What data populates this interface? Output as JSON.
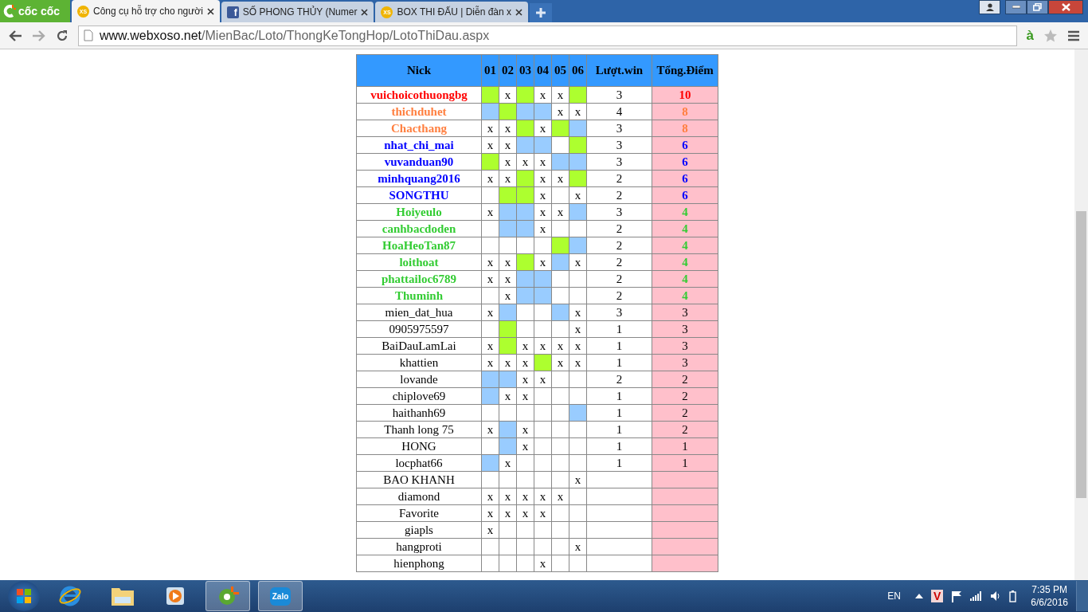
{
  "browser": {
    "logo": "cốc cốc",
    "tabs": [
      {
        "kind": "site",
        "icon_text": "XS",
        "title": "Công cụ hỗ trợ cho người",
        "selected": true
      },
      {
        "kind": "social",
        "icon_text": "f",
        "title": "SỐ PHONG THỦY (Numer",
        "selected": false
      },
      {
        "kind": "site",
        "icon_text": "XS",
        "title": "BOX THI ĐẤU | Diễn đàn x",
        "selected": false
      }
    ],
    "url": {
      "host": "www.webxoso.net",
      "path": "/MienBac/Loto/ThongKeTongHop/LotoThiDau.aspx"
    },
    "extension_text": "à"
  },
  "table": {
    "columns": {
      "nick": "Nick",
      "days": [
        "01",
        "02",
        "03",
        "04",
        "05",
        "06"
      ],
      "wins": "Lượt.win",
      "points": "Tổng.Điểm"
    },
    "rows": [
      {
        "nick": "vuichoicothuongbg",
        "color": "#ff0000",
        "bold": true,
        "cells": [
          {
            "kind": "win"
          },
          {
            "kind": "mark",
            "text": "x"
          },
          {
            "kind": "win"
          },
          {
            "kind": "mark",
            "text": "x"
          },
          {
            "kind": "mark",
            "text": "x"
          },
          {
            "kind": "win"
          }
        ],
        "wins": "3",
        "points": "10"
      },
      {
        "nick": "thichduhet",
        "color": "#ff7f3f",
        "bold": true,
        "cells": [
          {
            "kind": "near"
          },
          {
            "kind": "win"
          },
          {
            "kind": "near"
          },
          {
            "kind": "near"
          },
          {
            "kind": "mark",
            "text": "x"
          },
          {
            "kind": "mark",
            "text": "x"
          }
        ],
        "wins": "4",
        "points": "8"
      },
      {
        "nick": "Chacthang",
        "color": "#ff7f3f",
        "bold": true,
        "cells": [
          {
            "kind": "mark",
            "text": "x"
          },
          {
            "kind": "mark",
            "text": "x"
          },
          {
            "kind": "win"
          },
          {
            "kind": "mark",
            "text": "x"
          },
          {
            "kind": "win"
          },
          {
            "kind": "near"
          }
        ],
        "wins": "3",
        "points": "8"
      },
      {
        "nick": "nhat_chi_mai",
        "color": "#0000ff",
        "bold": true,
        "cells": [
          {
            "kind": "mark",
            "text": "x"
          },
          {
            "kind": "mark",
            "text": "x"
          },
          {
            "kind": "near"
          },
          {
            "kind": "near"
          },
          {
            "kind": "blank"
          },
          {
            "kind": "win"
          }
        ],
        "wins": "3",
        "points": "6"
      },
      {
        "nick": "vuvanduan90",
        "color": "#0000ff",
        "bold": true,
        "cells": [
          {
            "kind": "win"
          },
          {
            "kind": "mark",
            "text": "x"
          },
          {
            "kind": "mark",
            "text": "x"
          },
          {
            "kind": "mark",
            "text": "x"
          },
          {
            "kind": "near"
          },
          {
            "kind": "near"
          }
        ],
        "wins": "3",
        "points": "6"
      },
      {
        "nick": "minhquang2016",
        "color": "#0000ff",
        "bold": true,
        "cells": [
          {
            "kind": "mark",
            "text": "x"
          },
          {
            "kind": "mark",
            "text": "x"
          },
          {
            "kind": "win"
          },
          {
            "kind": "mark",
            "text": "x"
          },
          {
            "kind": "mark",
            "text": "x"
          },
          {
            "kind": "win"
          }
        ],
        "wins": "2",
        "points": "6"
      },
      {
        "nick": "SONGTHU",
        "color": "#0000ff",
        "bold": true,
        "cells": [
          {
            "kind": "blank"
          },
          {
            "kind": "win"
          },
          {
            "kind": "win"
          },
          {
            "kind": "mark",
            "text": "x"
          },
          {
            "kind": "blank"
          },
          {
            "kind": "mark",
            "text": "x"
          }
        ],
        "wins": "2",
        "points": "6"
      },
      {
        "nick": "Hoiyeulo",
        "color": "#33cc33",
        "bold": true,
        "cells": [
          {
            "kind": "mark",
            "text": "x"
          },
          {
            "kind": "near"
          },
          {
            "kind": "near"
          },
          {
            "kind": "mark",
            "text": "x"
          },
          {
            "kind": "mark",
            "text": "x"
          },
          {
            "kind": "near"
          }
        ],
        "wins": "3",
        "points": "4"
      },
      {
        "nick": "canhbacdoden",
        "color": "#33cc33",
        "bold": true,
        "cells": [
          {
            "kind": "blank"
          },
          {
            "kind": "near"
          },
          {
            "kind": "near"
          },
          {
            "kind": "mark",
            "text": "x"
          },
          {
            "kind": "blank"
          },
          {
            "kind": "blank"
          }
        ],
        "wins": "2",
        "points": "4"
      },
      {
        "nick": "HoaHeoTan87",
        "color": "#33cc33",
        "bold": true,
        "cells": [
          {
            "kind": "blank"
          },
          {
            "kind": "blank"
          },
          {
            "kind": "blank"
          },
          {
            "kind": "blank"
          },
          {
            "kind": "win"
          },
          {
            "kind": "near"
          }
        ],
        "wins": "2",
        "points": "4"
      },
      {
        "nick": "loithoat",
        "color": "#33cc33",
        "bold": true,
        "cells": [
          {
            "kind": "mark",
            "text": "x"
          },
          {
            "kind": "mark",
            "text": "x"
          },
          {
            "kind": "win"
          },
          {
            "kind": "mark",
            "text": "x"
          },
          {
            "kind": "near"
          },
          {
            "kind": "mark",
            "text": "x"
          }
        ],
        "wins": "2",
        "points": "4"
      },
      {
        "nick": "phattailoc6789",
        "color": "#33cc33",
        "bold": true,
        "cells": [
          {
            "kind": "mark",
            "text": "x"
          },
          {
            "kind": "mark",
            "text": "x"
          },
          {
            "kind": "near"
          },
          {
            "kind": "near"
          },
          {
            "kind": "blank"
          },
          {
            "kind": "blank"
          }
        ],
        "wins": "2",
        "points": "4"
      },
      {
        "nick": "Thuminh",
        "color": "#33cc33",
        "bold": true,
        "cells": [
          {
            "kind": "blank"
          },
          {
            "kind": "mark",
            "text": "x"
          },
          {
            "kind": "near"
          },
          {
            "kind": "near"
          },
          {
            "kind": "blank"
          },
          {
            "kind": "blank"
          }
        ],
        "wins": "2",
        "points": "4"
      },
      {
        "nick": "mien_dat_hua",
        "color": "#000000",
        "bold": false,
        "cells": [
          {
            "kind": "mark",
            "text": "x"
          },
          {
            "kind": "near"
          },
          {
            "kind": "blank"
          },
          {
            "kind": "blank"
          },
          {
            "kind": "near"
          },
          {
            "kind": "mark",
            "text": "x"
          }
        ],
        "wins": "3",
        "points": "3"
      },
      {
        "nick": "0905975597",
        "color": "#000000",
        "bold": false,
        "cells": [
          {
            "kind": "blank"
          },
          {
            "kind": "win"
          },
          {
            "kind": "blank"
          },
          {
            "kind": "blank"
          },
          {
            "kind": "blank"
          },
          {
            "kind": "mark",
            "text": "x"
          }
        ],
        "wins": "1",
        "points": "3"
      },
      {
        "nick": "BaiDauLamLai",
        "color": "#000000",
        "bold": false,
        "cells": [
          {
            "kind": "mark",
            "text": "x"
          },
          {
            "kind": "win"
          },
          {
            "kind": "mark",
            "text": "x"
          },
          {
            "kind": "mark",
            "text": "x"
          },
          {
            "kind": "mark",
            "text": "x"
          },
          {
            "kind": "mark",
            "text": "x"
          }
        ],
        "wins": "1",
        "points": "3"
      },
      {
        "nick": "khattien",
        "color": "#000000",
        "bold": false,
        "cells": [
          {
            "kind": "mark",
            "text": "x"
          },
          {
            "kind": "mark",
            "text": "x"
          },
          {
            "kind": "mark",
            "text": "x"
          },
          {
            "kind": "win"
          },
          {
            "kind": "mark",
            "text": "x"
          },
          {
            "kind": "mark",
            "text": "x"
          }
        ],
        "wins": "1",
        "points": "3"
      },
      {
        "nick": "lovande",
        "color": "#000000",
        "bold": false,
        "cells": [
          {
            "kind": "near"
          },
          {
            "kind": "near"
          },
          {
            "kind": "mark",
            "text": "x"
          },
          {
            "kind": "mark",
            "text": "x"
          },
          {
            "kind": "blank"
          },
          {
            "kind": "blank"
          }
        ],
        "wins": "2",
        "points": "2"
      },
      {
        "nick": "chiplove69",
        "color": "#000000",
        "bold": false,
        "cells": [
          {
            "kind": "near"
          },
          {
            "kind": "mark",
            "text": "x"
          },
          {
            "kind": "mark",
            "text": "x"
          },
          {
            "kind": "blank"
          },
          {
            "kind": "blank"
          },
          {
            "kind": "blank"
          }
        ],
        "wins": "1",
        "points": "2"
      },
      {
        "nick": "haithanh69",
        "color": "#000000",
        "bold": false,
        "cells": [
          {
            "kind": "blank"
          },
          {
            "kind": "blank"
          },
          {
            "kind": "blank"
          },
          {
            "kind": "blank"
          },
          {
            "kind": "blank"
          },
          {
            "kind": "near"
          }
        ],
        "wins": "1",
        "points": "2"
      },
      {
        "nick": "Thanh long 75",
        "color": "#000000",
        "bold": false,
        "cells": [
          {
            "kind": "mark",
            "text": "x"
          },
          {
            "kind": "near"
          },
          {
            "kind": "mark",
            "text": "x"
          },
          {
            "kind": "blank"
          },
          {
            "kind": "blank"
          },
          {
            "kind": "blank"
          }
        ],
        "wins": "1",
        "points": "2"
      },
      {
        "nick": "HONG",
        "color": "#000000",
        "bold": false,
        "cells": [
          {
            "kind": "blank"
          },
          {
            "kind": "near"
          },
          {
            "kind": "mark",
            "text": "x"
          },
          {
            "kind": "blank"
          },
          {
            "kind": "blank"
          },
          {
            "kind": "blank"
          }
        ],
        "wins": "1",
        "points": "1"
      },
      {
        "nick": "locphat66",
        "color": "#000000",
        "bold": false,
        "cells": [
          {
            "kind": "near"
          },
          {
            "kind": "mark",
            "text": "x"
          },
          {
            "kind": "blank"
          },
          {
            "kind": "blank"
          },
          {
            "kind": "blank"
          },
          {
            "kind": "blank"
          }
        ],
        "wins": "1",
        "points": "1"
      },
      {
        "nick": "BAO KHANH",
        "color": "#000000",
        "bold": false,
        "cells": [
          {
            "kind": "blank"
          },
          {
            "kind": "blank"
          },
          {
            "kind": "blank"
          },
          {
            "kind": "blank"
          },
          {
            "kind": "blank"
          },
          {
            "kind": "mark",
            "text": "x"
          }
        ]
      },
      {
        "nick": "diamond",
        "color": "#000000",
        "bold": false,
        "cells": [
          {
            "kind": "mark",
            "text": "x"
          },
          {
            "kind": "mark",
            "text": "x"
          },
          {
            "kind": "mark",
            "text": "x"
          },
          {
            "kind": "mark",
            "text": "x"
          },
          {
            "kind": "mark",
            "text": "x"
          },
          {
            "kind": "blank"
          }
        ]
      },
      {
        "nick": "Favorite",
        "color": "#000000",
        "bold": false,
        "cells": [
          {
            "kind": "mark",
            "text": "x"
          },
          {
            "kind": "mark",
            "text": "x"
          },
          {
            "kind": "mark",
            "text": "x"
          },
          {
            "kind": "mark",
            "text": "x"
          },
          {
            "kind": "blank"
          },
          {
            "kind": "blank"
          }
        ]
      },
      {
        "nick": "giapls",
        "color": "#000000",
        "bold": false,
        "cells": [
          {
            "kind": "mark",
            "text": "x"
          },
          {
            "kind": "blank"
          },
          {
            "kind": "blank"
          },
          {
            "kind": "blank"
          },
          {
            "kind": "blank"
          },
          {
            "kind": "blank"
          }
        ]
      },
      {
        "nick": "hangproti",
        "color": "#000000",
        "bold": false,
        "cells": [
          {
            "kind": "blank"
          },
          {
            "kind": "blank"
          },
          {
            "kind": "blank"
          },
          {
            "kind": "blank"
          },
          {
            "kind": "blank"
          },
          {
            "kind": "mark",
            "text": "x"
          }
        ]
      },
      {
        "nick": "hienphong",
        "color": "#000000",
        "bold": false,
        "cells": [
          {
            "kind": "blank"
          },
          {
            "kind": "blank"
          },
          {
            "kind": "blank"
          },
          {
            "kind": "mark",
            "text": "x"
          },
          {
            "kind": "blank"
          },
          {
            "kind": "blank"
          }
        ]
      }
    ]
  },
  "taskbar": {
    "apps": [
      {
        "kind": "ie",
        "active": false
      },
      {
        "kind": "folder",
        "active": false
      },
      {
        "kind": "media",
        "active": false
      },
      {
        "kind": "coccoc",
        "active": true
      },
      {
        "kind": "zalo",
        "active": true,
        "label": "Zalo"
      }
    ],
    "language": "EN",
    "tray_app_text": "V",
    "time": "7:35 PM",
    "date": "6/6/2016"
  }
}
